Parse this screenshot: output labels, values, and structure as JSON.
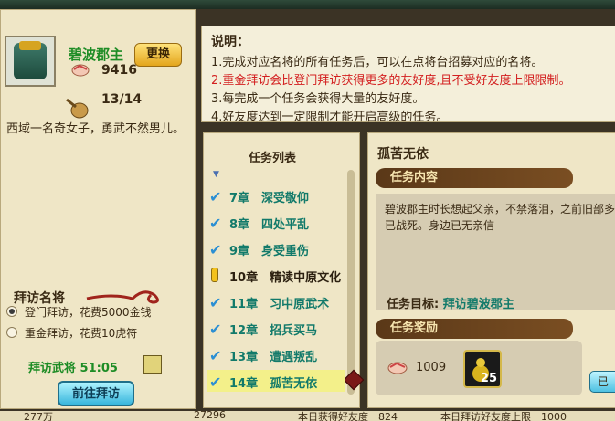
{
  "character": {
    "name": "碧波郡主",
    "swap_label": "更换",
    "friendship": "9416",
    "energy": "13/14",
    "description": "西域一名奇女子，勇武不然男儿。"
  },
  "visit": {
    "title": "拜访名将",
    "options": [
      {
        "label": "登门拜访，花费5000金钱",
        "selected": true
      },
      {
        "label": "重金拜访，花费10虎符",
        "selected": false
      }
    ],
    "timer": "拜访武将 51:05",
    "go_label": "前往拜访"
  },
  "info": {
    "heading": "说明：",
    "lines": [
      "1.完成对应名将的所有任务后，可以在点将台招募对应的名将。",
      "2.重金拜访会比登门拜访获得更多的友好度,且不受好友度上限限制。",
      "3.每完成一个任务会获得大量的友好度。",
      "4.好友度达到一定限制才能开启高级的任务。"
    ]
  },
  "task_list": {
    "header": "任务列表",
    "items": [
      {
        "label": "7章　深受敬仰",
        "status": "done"
      },
      {
        "label": "8章　四处平乱",
        "status": "done"
      },
      {
        "label": "9章　身受重伤",
        "status": "done"
      },
      {
        "label": "10章　精读中原文化",
        "status": "pending"
      },
      {
        "label": "11章　习中原武术",
        "status": "done"
      },
      {
        "label": "12章　招兵买马",
        "status": "done"
      },
      {
        "label": "13章　遭遇叛乱",
        "status": "done"
      },
      {
        "label": "14章　孤苦无依",
        "status": "done",
        "selected": true
      }
    ]
  },
  "detail": {
    "title": "孤苦无依",
    "content_label": "任务内容",
    "content": "碧波郡主时长想起父亲，不禁落泪，之前旧部多已战死。身边已无亲信",
    "goal_label": "任务目标:",
    "goal": "拜访碧波郡主",
    "reward_label": "任务奖励",
    "reward_value": "1009",
    "item_count": "25",
    "edge_button": "已"
  },
  "footer": {
    "a": "277万",
    "b": "27296",
    "c": "本日获得好友度　824",
    "d": "本日拜访好友度上限　1000"
  },
  "colors": {
    "accent_green": "#1d8c25",
    "teal": "#127a6a",
    "warning_red": "#d32020"
  }
}
